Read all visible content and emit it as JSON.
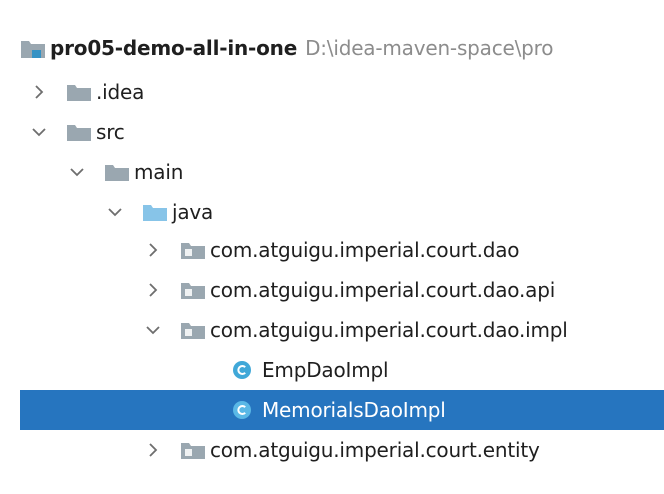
{
  "project_tree": {
    "root": {
      "name": "pro05-demo-all-in-one",
      "path": "D:\\idea-maven-space\\pro"
    },
    "items": [
      {
        "label": ".idea"
      },
      {
        "label": "src"
      },
      {
        "label": "main"
      },
      {
        "label": "java"
      },
      {
        "label": "com.atguigu.imperial.court.dao"
      },
      {
        "label": "com.atguigu.imperial.court.dao.api"
      },
      {
        "label": "com.atguigu.imperial.court.dao.impl"
      },
      {
        "label": "EmpDaoImpl"
      },
      {
        "label": "MemorialsDaoImpl"
      },
      {
        "label": "com.atguigu.imperial.court.entity"
      }
    ]
  },
  "colors": {
    "selection": "#2675bf",
    "folder": "#9aa7b0",
    "source_folder": "#87c4e8",
    "class_icon": "#40a8d8",
    "path_text": "#8c8c8c"
  },
  "icons": {
    "expanded": "chevron-down-icon",
    "collapsed": "chevron-right-icon",
    "module": "module-folder-icon",
    "folder": "folder-icon",
    "source_root": "source-root-folder-icon",
    "package": "package-folder-icon",
    "class": "java-class-icon"
  }
}
